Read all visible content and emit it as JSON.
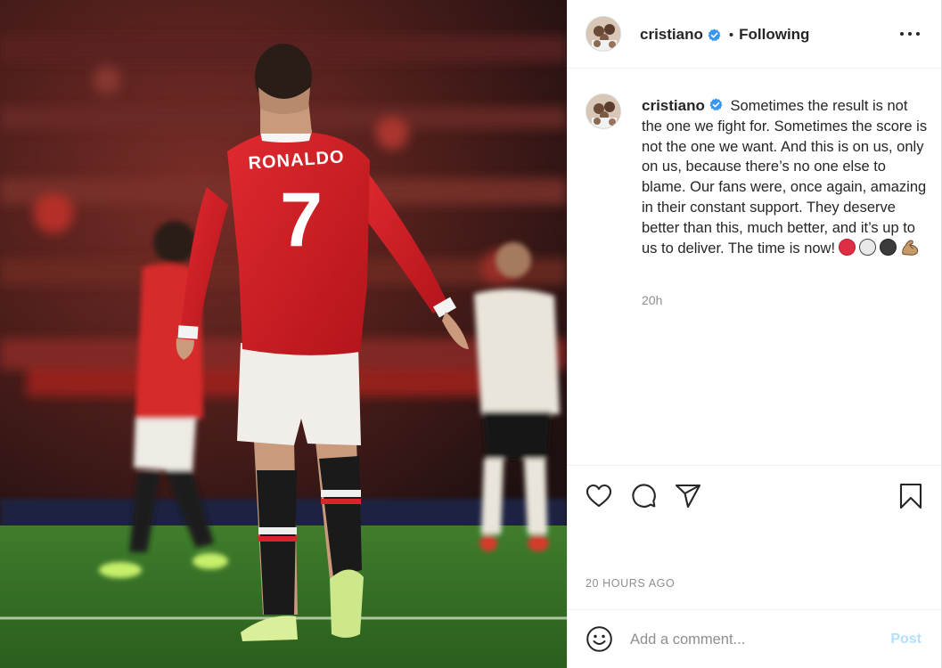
{
  "post": {
    "photo": {
      "shirt_name": "RONALDO",
      "shirt_number": "7"
    },
    "header": {
      "username": "cristiano",
      "separator": "•",
      "follow_state": "Following"
    },
    "caption": {
      "username": "cristiano",
      "text": "Sometimes the result is not the one we fight for. Sometimes the score is not the one we want. And this is on us, only on us, because there’s no one else to blame. Our fans were, once again, amazing in their constant support. They deserve better than this, much better, and it’s up to us to deliver. The time is now!",
      "emojis": [
        "red-circle",
        "white-circle",
        "black-circle",
        "flexed-biceps"
      ],
      "time_ago": "20h"
    },
    "timestamp": "20 HOURS AGO",
    "comment_box": {
      "placeholder": "Add a comment...",
      "post_label": "Post"
    }
  },
  "colors": {
    "text": "#262626",
    "secondary_text": "#8e8e8e",
    "verified_blue": "#3897f0",
    "post_button_disabled": "#b2dffc",
    "border": "#efefef",
    "jersey_red": "#cf1b22"
  },
  "icons": {
    "verified": "verified-badge-icon",
    "more": "more-options-icon",
    "like": "heart-icon",
    "comment": "speech-bubble-icon",
    "share": "paper-plane-icon",
    "save": "bookmark-icon",
    "emoji": "smiley-icon"
  }
}
